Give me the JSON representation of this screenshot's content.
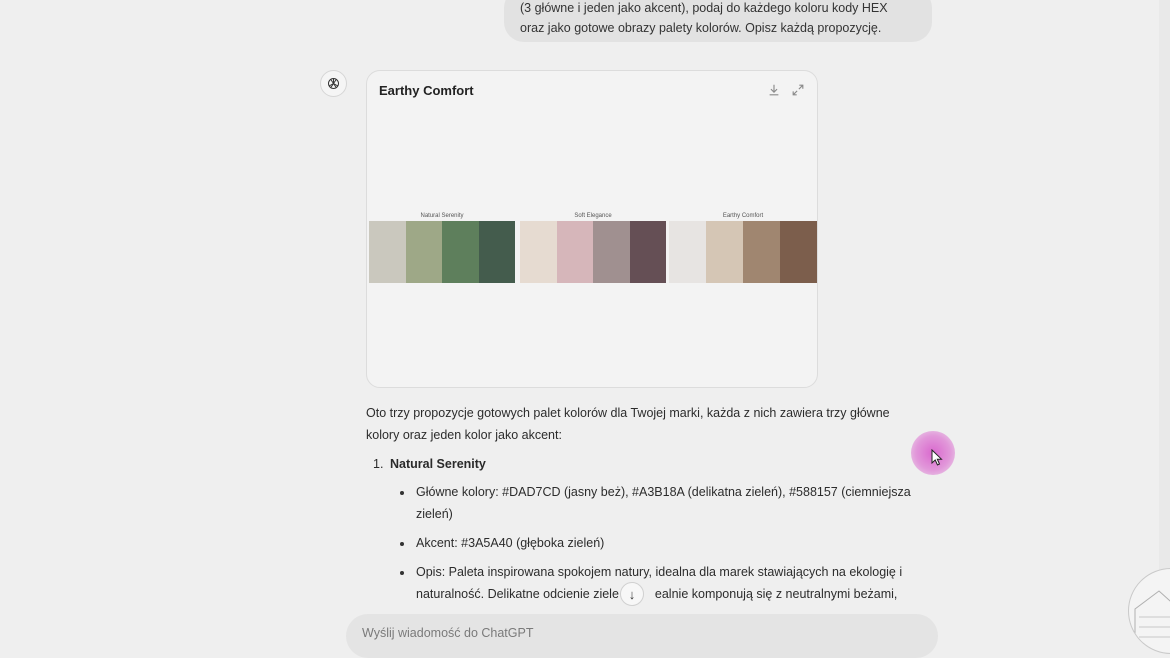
{
  "user_message": {
    "line1": "(3 główne i jeden jako akcent), podaj do każdego koloru kody HEX",
    "line2": "oraz jako gotowe obrazy palety kolorów. Opisz każdą propozycję."
  },
  "assistant": {
    "avatar_icon": "openai-logo-icon",
    "image_card": {
      "title": "Earthy Comfort",
      "download_icon": "download-icon",
      "expand_icon": "expand-icon",
      "palettes": [
        {
          "label": "Natural Serenity",
          "colors": [
            "#CAC8BE",
            "#9EA887",
            "#5E7F5C",
            "#445C4D"
          ]
        },
        {
          "label": "Soft Elegance",
          "colors": [
            "#E6DBD1",
            "#D6B6BA",
            "#A09090",
            "#654F55"
          ]
        },
        {
          "label": "Earthy Comfort",
          "colors": [
            "#E7E4E2",
            "#D5C6B5",
            "#A08670",
            "#7C5E4C"
          ]
        }
      ]
    },
    "intro_line1": "Oto trzy propozycje gotowych palet kolorów dla Twojej marki, każda z nich zawiera trzy główne",
    "intro_line2": "kolory oraz jeden kolor jako akcent:",
    "list": [
      {
        "number": "1.",
        "title": "Natural Serenity",
        "bullets": [
          {
            "line1": "Główne kolory: #DAD7CD (jasny beż), #A3B18A (delikatna zieleń), #588157 (ciemniejsza",
            "line2": "zieleń)"
          },
          {
            "line1": "Akcent: #3A5A40 (głęboka zieleń)",
            "line2": ""
          },
          {
            "line1": "Opis: Paleta inspirowana spokojem natury, idealna dla marek stawiających na ekologię i",
            "line2a": "naturalność. Delikatne odcienie ziele",
            "line2b": "ealnie komponują się z neutralnymi beżami,"
          }
        ]
      }
    ]
  },
  "scroll_down_icon": "arrow-down-icon",
  "scroll_down_glyph": "↓",
  "composer": {
    "placeholder": "Wyślij wiadomość do ChatGPT"
  },
  "cursor_icon": "mouse-pointer-icon"
}
